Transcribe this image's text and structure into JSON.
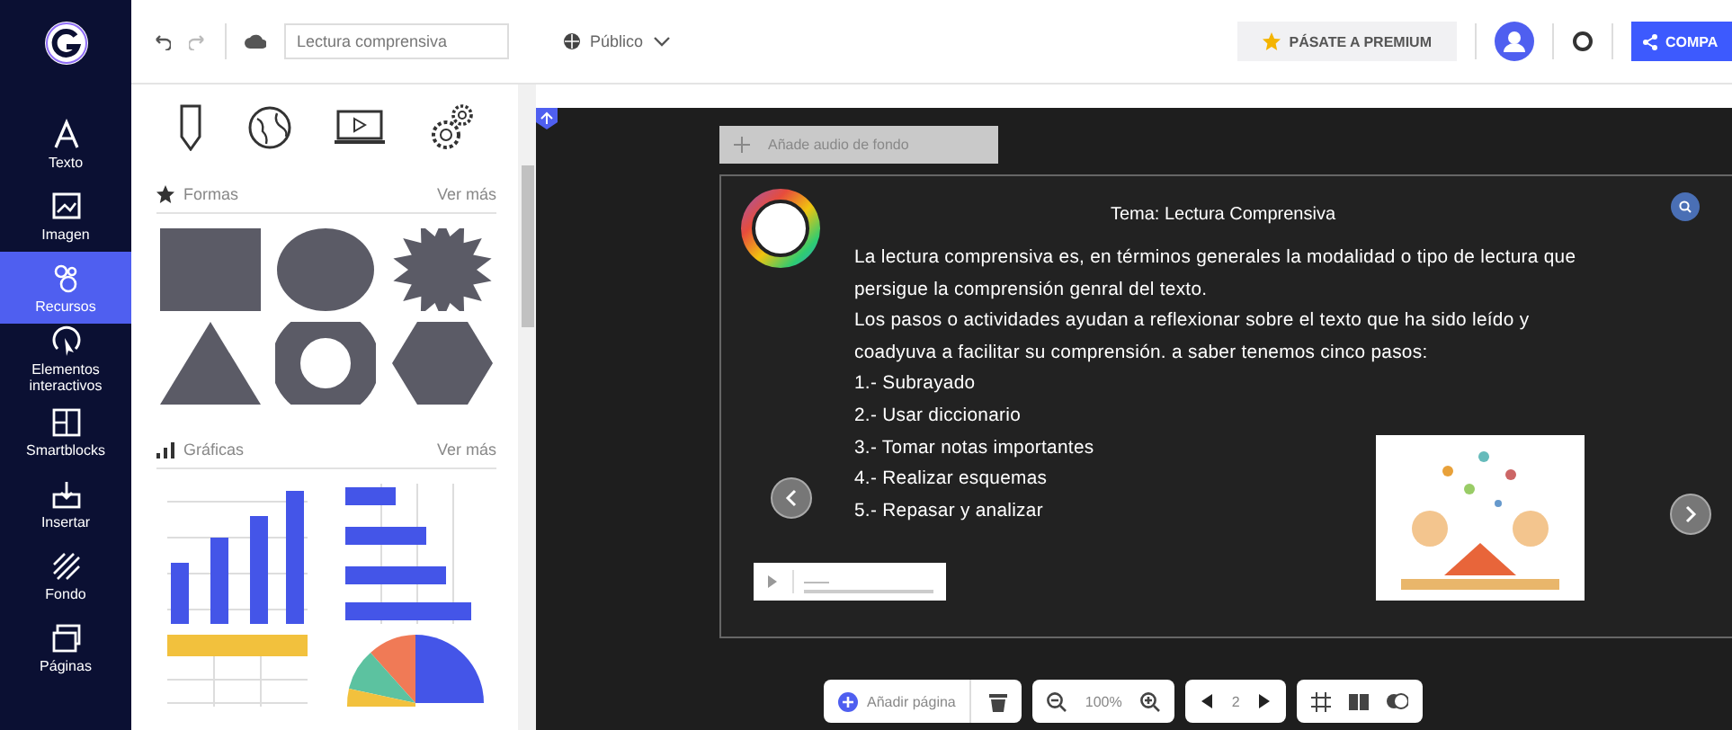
{
  "top_bar": {
    "document_title": "Lectura comprensiva",
    "visibility": "Público",
    "premium_button": "PÁSATE A PREMIUM",
    "share_button": "COMPA"
  },
  "nav": [
    {
      "label": "Texto",
      "selected": false
    },
    {
      "label": "Imagen",
      "selected": false
    },
    {
      "label": "Recursos",
      "selected": true
    },
    {
      "label": "Elementos interactivos",
      "selected": false
    },
    {
      "label": "Smartblocks",
      "selected": false
    },
    {
      "label": "Insertar",
      "selected": false
    },
    {
      "label": "Fondo",
      "selected": false
    },
    {
      "label": "Páginas",
      "selected": false
    }
  ],
  "panel": {
    "sections": [
      {
        "kind": "shapes",
        "title": "Formas",
        "link": "Ver más"
      },
      {
        "kind": "charts",
        "title": "Gráficas",
        "link": "Ver más"
      }
    ]
  },
  "canvas": {
    "audio_button": "Añade audio de fondo",
    "slide": {
      "title": "Tema: Lectura Comprensiva",
      "paragraphs": [
        "La lectura comprensiva es, en términos generales la modalidad o tipo de lectura que persigue la comprensión genral del texto.",
        "Los pasos o actividades ayudan a reflexionar sobre el texto que ha sido leído y coadyuva a facilitar su comprensión. a saber tenemos cinco pasos:"
      ],
      "steps": [
        "1.- Subrayado",
        "2.- Usar diccionario",
        "3.- Tomar notas importantes",
        "4.- Realizar esquemas",
        "5.- Repasar y analizar"
      ]
    }
  },
  "bottom_toolbar": {
    "add_page": "Añadir página",
    "zoom": "100%",
    "page": "2"
  }
}
